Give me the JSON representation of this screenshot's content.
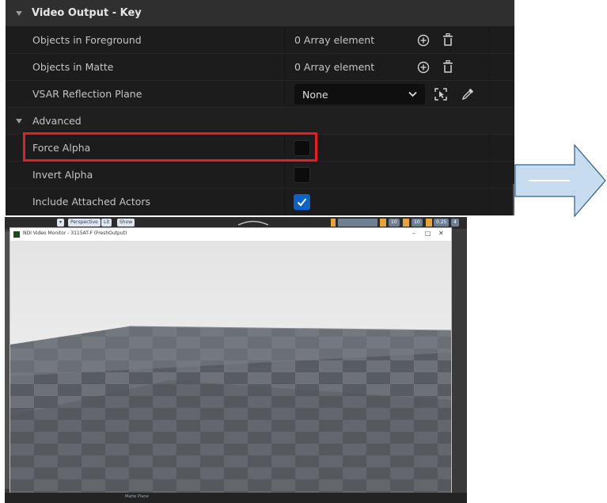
{
  "details_panel": {
    "category_title": "Video Output - Key",
    "rows": [
      {
        "label": "Objects in Foreground",
        "value": "0 Array element"
      },
      {
        "label": "Objects in Matte",
        "value": "0 Array element"
      },
      {
        "label": "VSAR Reflection Plane",
        "value": "None"
      }
    ],
    "advanced": {
      "title": "Advanced",
      "rows": [
        {
          "label": "Force Alpha",
          "checked": false
        },
        {
          "label": "Invert Alpha",
          "checked": false
        },
        {
          "label": "Include Attached Actors",
          "checked": true
        }
      ]
    },
    "highlight_color": "#e41e26",
    "checkbox_checked_color": "#0b63c8"
  },
  "arrow": {
    "fill": "#c8dcef",
    "stroke": "#2b5f8f"
  },
  "viewport": {
    "toolbar": {
      "buttons": [
        "Perspective",
        "Lit",
        "Show"
      ],
      "numbers": [
        "10",
        "10",
        "0.25",
        "4"
      ]
    },
    "monitor_window": {
      "title": "NDI Video Monitor - 3115AT-F (FreshOutput)",
      "minimize": "–",
      "maximize": "□",
      "close": "✕"
    },
    "bottom_label": "Matte Plane"
  }
}
